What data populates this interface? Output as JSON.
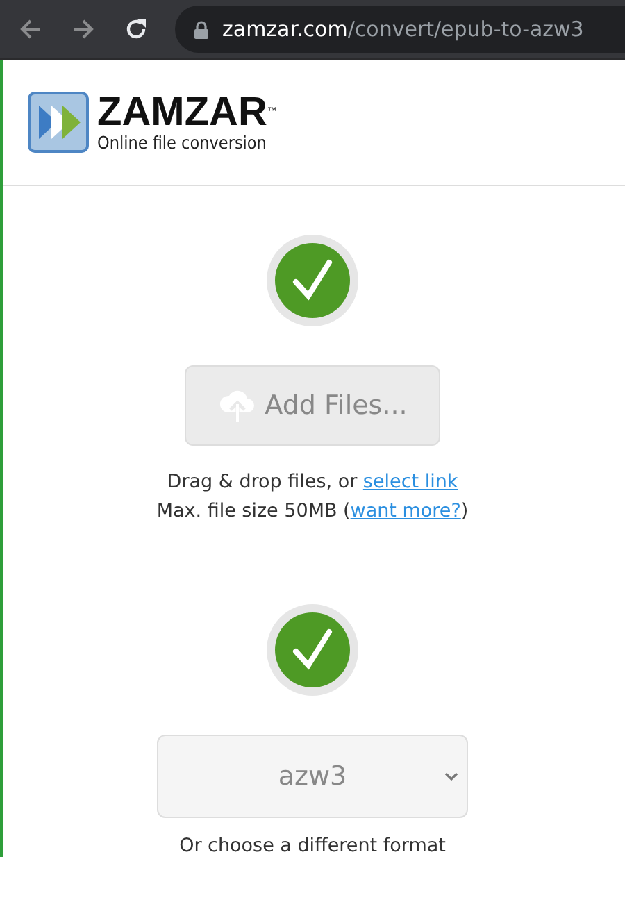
{
  "browser": {
    "url_host": "zamzar.com",
    "url_path": "/convert/epub-to-azw3"
  },
  "header": {
    "logo_name": "ZAMZAR",
    "logo_mark": "™",
    "tagline": "Online file conversion"
  },
  "step_1": {
    "done": true,
    "button": {
      "label": "Add Files...",
      "disabled": true
    },
    "hint": "Drag & drop files, or ",
    "hint_link": "select link",
    "limit": "Max. file size 50MB (",
    "limit_link": "want more?",
    "limit_end": ")"
  },
  "step_2": {
    "done": true,
    "format_select": {
      "value": "azw3",
      "disabled": true
    },
    "caption": "Or choose a different format"
  }
}
